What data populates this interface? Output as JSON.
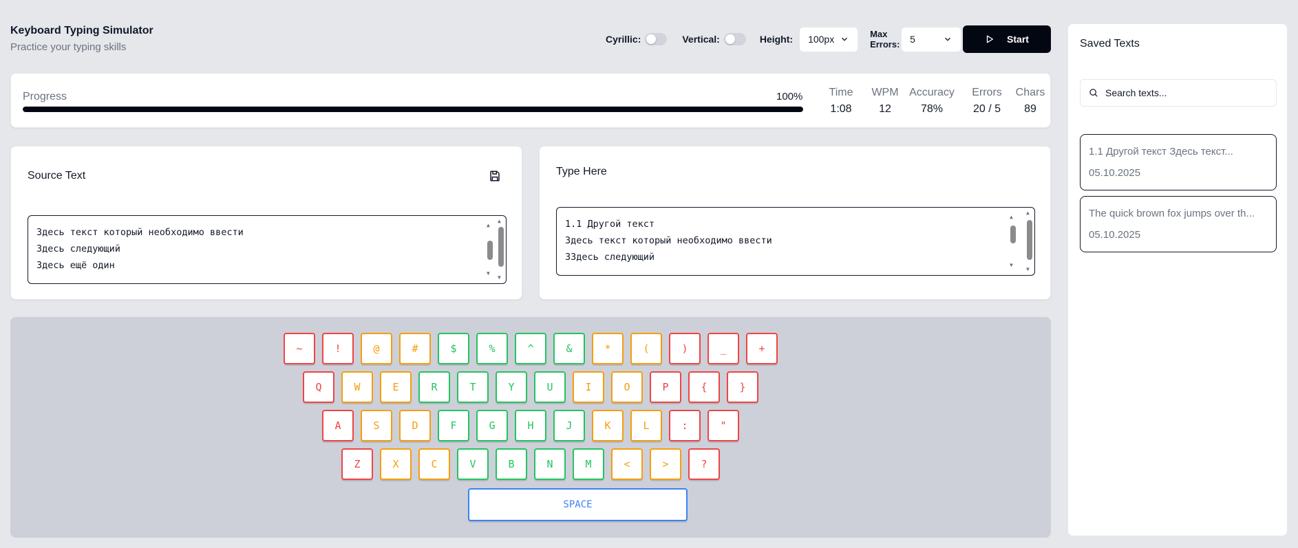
{
  "header": {
    "title": "Keyboard Typing Simulator",
    "subtitle": "Practice your typing skills"
  },
  "controls": {
    "cyrillic_label": "Cyrillic:",
    "cyrillic_on": false,
    "vertical_label": "Vertical:",
    "vertical_on": false,
    "height_label": "Height:",
    "height_value": "100px",
    "max_errors_label": "Max Errors:",
    "max_errors_value": "5",
    "start_label": "Start"
  },
  "progress": {
    "label": "Progress",
    "percent_text": "100%",
    "fraction": 1.0
  },
  "stats": [
    {
      "label": "Time",
      "value": "1:08"
    },
    {
      "label": "WPM",
      "value": "12"
    },
    {
      "label": "Accuracy",
      "value": "78%"
    },
    {
      "label": "Errors",
      "value": "20 / 5"
    },
    {
      "label": "Chars",
      "value": "89"
    }
  ],
  "source": {
    "heading": "Source Text",
    "lines": [
      "Здесь текст который необходимо ввести",
      "Здесь следующий",
      "Здесь ещё один"
    ]
  },
  "typed": {
    "heading": "Type Here",
    "lines": [
      "1.1 Другой текст",
      "Здесь текст который необходимо ввести",
      "3Здесь следующий"
    ]
  },
  "keyboard": {
    "rows": [
      [
        {
          "c": "~",
          "s": "red"
        },
        {
          "c": "!",
          "s": "red"
        },
        {
          "c": "@",
          "s": "amber"
        },
        {
          "c": "#",
          "s": "amber"
        },
        {
          "c": "$",
          "s": "green"
        },
        {
          "c": "%",
          "s": "green"
        },
        {
          "c": "^",
          "s": "green"
        },
        {
          "c": "&",
          "s": "green"
        },
        {
          "c": "*",
          "s": "amber"
        },
        {
          "c": "(",
          "s": "amber"
        },
        {
          "c": ")",
          "s": "red"
        },
        {
          "c": "_",
          "s": "red"
        },
        {
          "c": "+",
          "s": "red"
        }
      ],
      [
        {
          "c": "Q",
          "s": "red"
        },
        {
          "c": "W",
          "s": "amber"
        },
        {
          "c": "E",
          "s": "amber"
        },
        {
          "c": "R",
          "s": "green"
        },
        {
          "c": "T",
          "s": "green"
        },
        {
          "c": "Y",
          "s": "green"
        },
        {
          "c": "U",
          "s": "green"
        },
        {
          "c": "I",
          "s": "amber"
        },
        {
          "c": "O",
          "s": "amber"
        },
        {
          "c": "P",
          "s": "red"
        },
        {
          "c": "{",
          "s": "red"
        },
        {
          "c": "}",
          "s": "red"
        }
      ],
      [
        {
          "c": "A",
          "s": "red"
        },
        {
          "c": "S",
          "s": "amber"
        },
        {
          "c": "D",
          "s": "amber"
        },
        {
          "c": "F",
          "s": "green"
        },
        {
          "c": "G",
          "s": "green"
        },
        {
          "c": "H",
          "s": "green"
        },
        {
          "c": "J",
          "s": "green"
        },
        {
          "c": "K",
          "s": "amber"
        },
        {
          "c": "L",
          "s": "amber"
        },
        {
          "c": ":",
          "s": "red"
        },
        {
          "c": "\"",
          "s": "red"
        }
      ],
      [
        {
          "c": "Z",
          "s": "red"
        },
        {
          "c": "X",
          "s": "amber"
        },
        {
          "c": "C",
          "s": "amber"
        },
        {
          "c": "V",
          "s": "green"
        },
        {
          "c": "B",
          "s": "green"
        },
        {
          "c": "N",
          "s": "green"
        },
        {
          "c": "M",
          "s": "green"
        },
        {
          "c": "<",
          "s": "amber"
        },
        {
          "c": ">",
          "s": "amber"
        },
        {
          "c": "?",
          "s": "red"
        }
      ]
    ],
    "space_label": "SPACE"
  },
  "sidebar": {
    "title": "Saved Texts",
    "search_placeholder": "Search texts...",
    "items": [
      {
        "title": "1.1 Другой текст Здесь текст...",
        "date": "05.10.2025"
      },
      {
        "title": "The quick brown fox jumps over th...",
        "date": "05.10.2025"
      }
    ]
  },
  "colors": {
    "accent": "#030712",
    "key_red": "#ef4444",
    "key_amber": "#f59e0b",
    "key_green": "#22c55e",
    "space_blue": "#3b82f6"
  }
}
